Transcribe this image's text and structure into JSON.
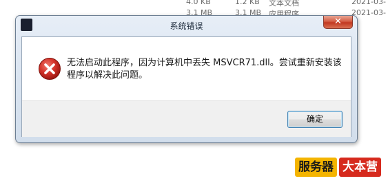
{
  "background_rows": [
    {
      "size_a": "4.0 KB",
      "size_b": "1.2 KB",
      "type": "文本文档",
      "date": "2021-03-"
    },
    {
      "size_a": "3.1 MB",
      "size_b": "3.1 MB",
      "type": "应用程序",
      "date": "2021-03-"
    }
  ],
  "dialog": {
    "title": "系统错误",
    "close_glyph": "✕",
    "message": "无法启动此程序，因为计算机中丢失 MSVCR71.dll。尝试重新安装该程序以解决此问题。",
    "ok_label": "确定"
  },
  "watermark": {
    "part1": "服务器",
    "part2": "大本营"
  },
  "colors": {
    "error_icon": "#cc2424",
    "close_button": "#c2381f",
    "accent_border": "#3c7fb1"
  }
}
